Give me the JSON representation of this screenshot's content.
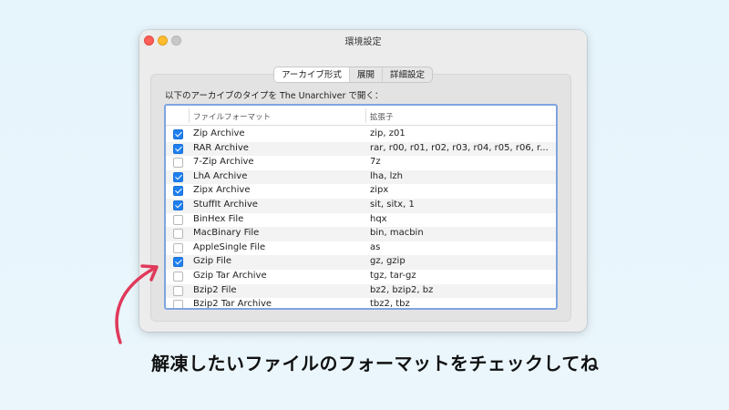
{
  "window": {
    "title": "環境設定"
  },
  "tabs": [
    {
      "label": "アーカイブ形式",
      "active": true
    },
    {
      "label": "展開",
      "active": false
    },
    {
      "label": "詳細設定",
      "active": false
    }
  ],
  "description": "以下のアーカイブのタイプを The Unarchiver で開く：",
  "table": {
    "headers": {
      "format": "ファイルフォーマット",
      "extensions": "拡張子"
    },
    "rows": [
      {
        "checked": true,
        "name": "Zip Archive",
        "ext": "zip, z01"
      },
      {
        "checked": true,
        "name": "RAR Archive",
        "ext": "rar, r00, r01, r02, r03, r04, r05, r06, r..."
      },
      {
        "checked": false,
        "name": "7-Zip Archive",
        "ext": "7z"
      },
      {
        "checked": true,
        "name": "LhA Archive",
        "ext": "lha, lzh"
      },
      {
        "checked": true,
        "name": "Zipx Archive",
        "ext": "zipx"
      },
      {
        "checked": true,
        "name": "StuffIt Archive",
        "ext": "sit, sitx, 1"
      },
      {
        "checked": false,
        "name": "BinHex File",
        "ext": "hqx"
      },
      {
        "checked": false,
        "name": "MacBinary File",
        "ext": "bin, macbin"
      },
      {
        "checked": false,
        "name": "AppleSingle File",
        "ext": "as"
      },
      {
        "checked": true,
        "name": "Gzip File",
        "ext": "gz, gzip"
      },
      {
        "checked": false,
        "name": "Gzip Tar Archive",
        "ext": "tgz, tar-gz"
      },
      {
        "checked": false,
        "name": "Bzip2 File",
        "ext": "bz2, bzip2, bz"
      },
      {
        "checked": false,
        "name": "Bzip2 Tar Archive",
        "ext": "tbz2, tbz"
      }
    ]
  },
  "caption": "解凍したいファイルのフォーマットをチェックしてね",
  "colors": {
    "accent": "#1f7ff0",
    "arrow": "#e0395a",
    "table_border": "#7ea4e0"
  }
}
